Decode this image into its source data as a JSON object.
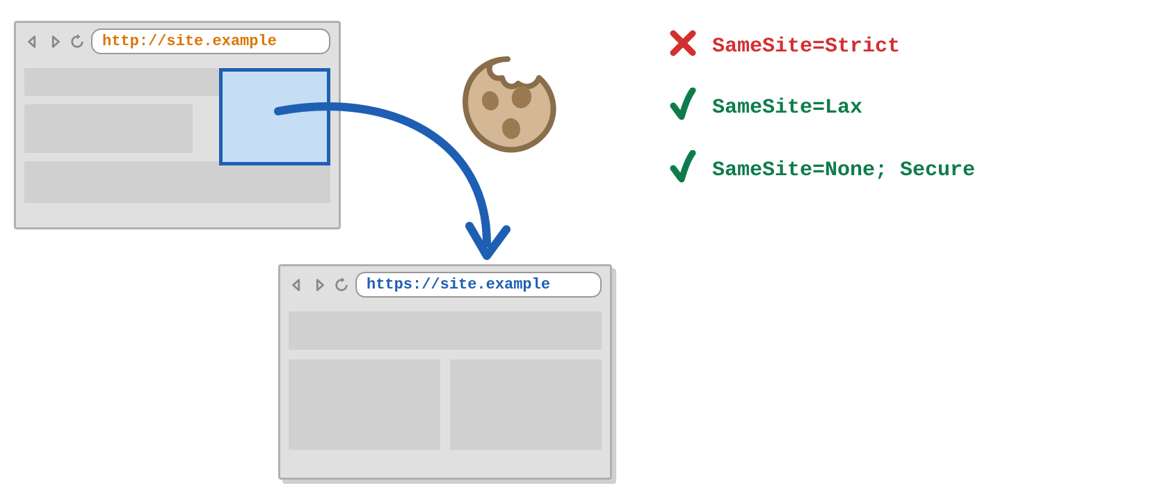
{
  "browsers": {
    "source": {
      "url": "http://site.example"
    },
    "target": {
      "url": "https://site.example"
    }
  },
  "rules": [
    {
      "status": "cross",
      "text": "SameSite=Strict"
    },
    {
      "status": "check",
      "text": "SameSite=Lax"
    },
    {
      "status": "check",
      "text": "SameSite=None; Secure"
    }
  ],
  "icons": {
    "cookie": "cookie"
  }
}
